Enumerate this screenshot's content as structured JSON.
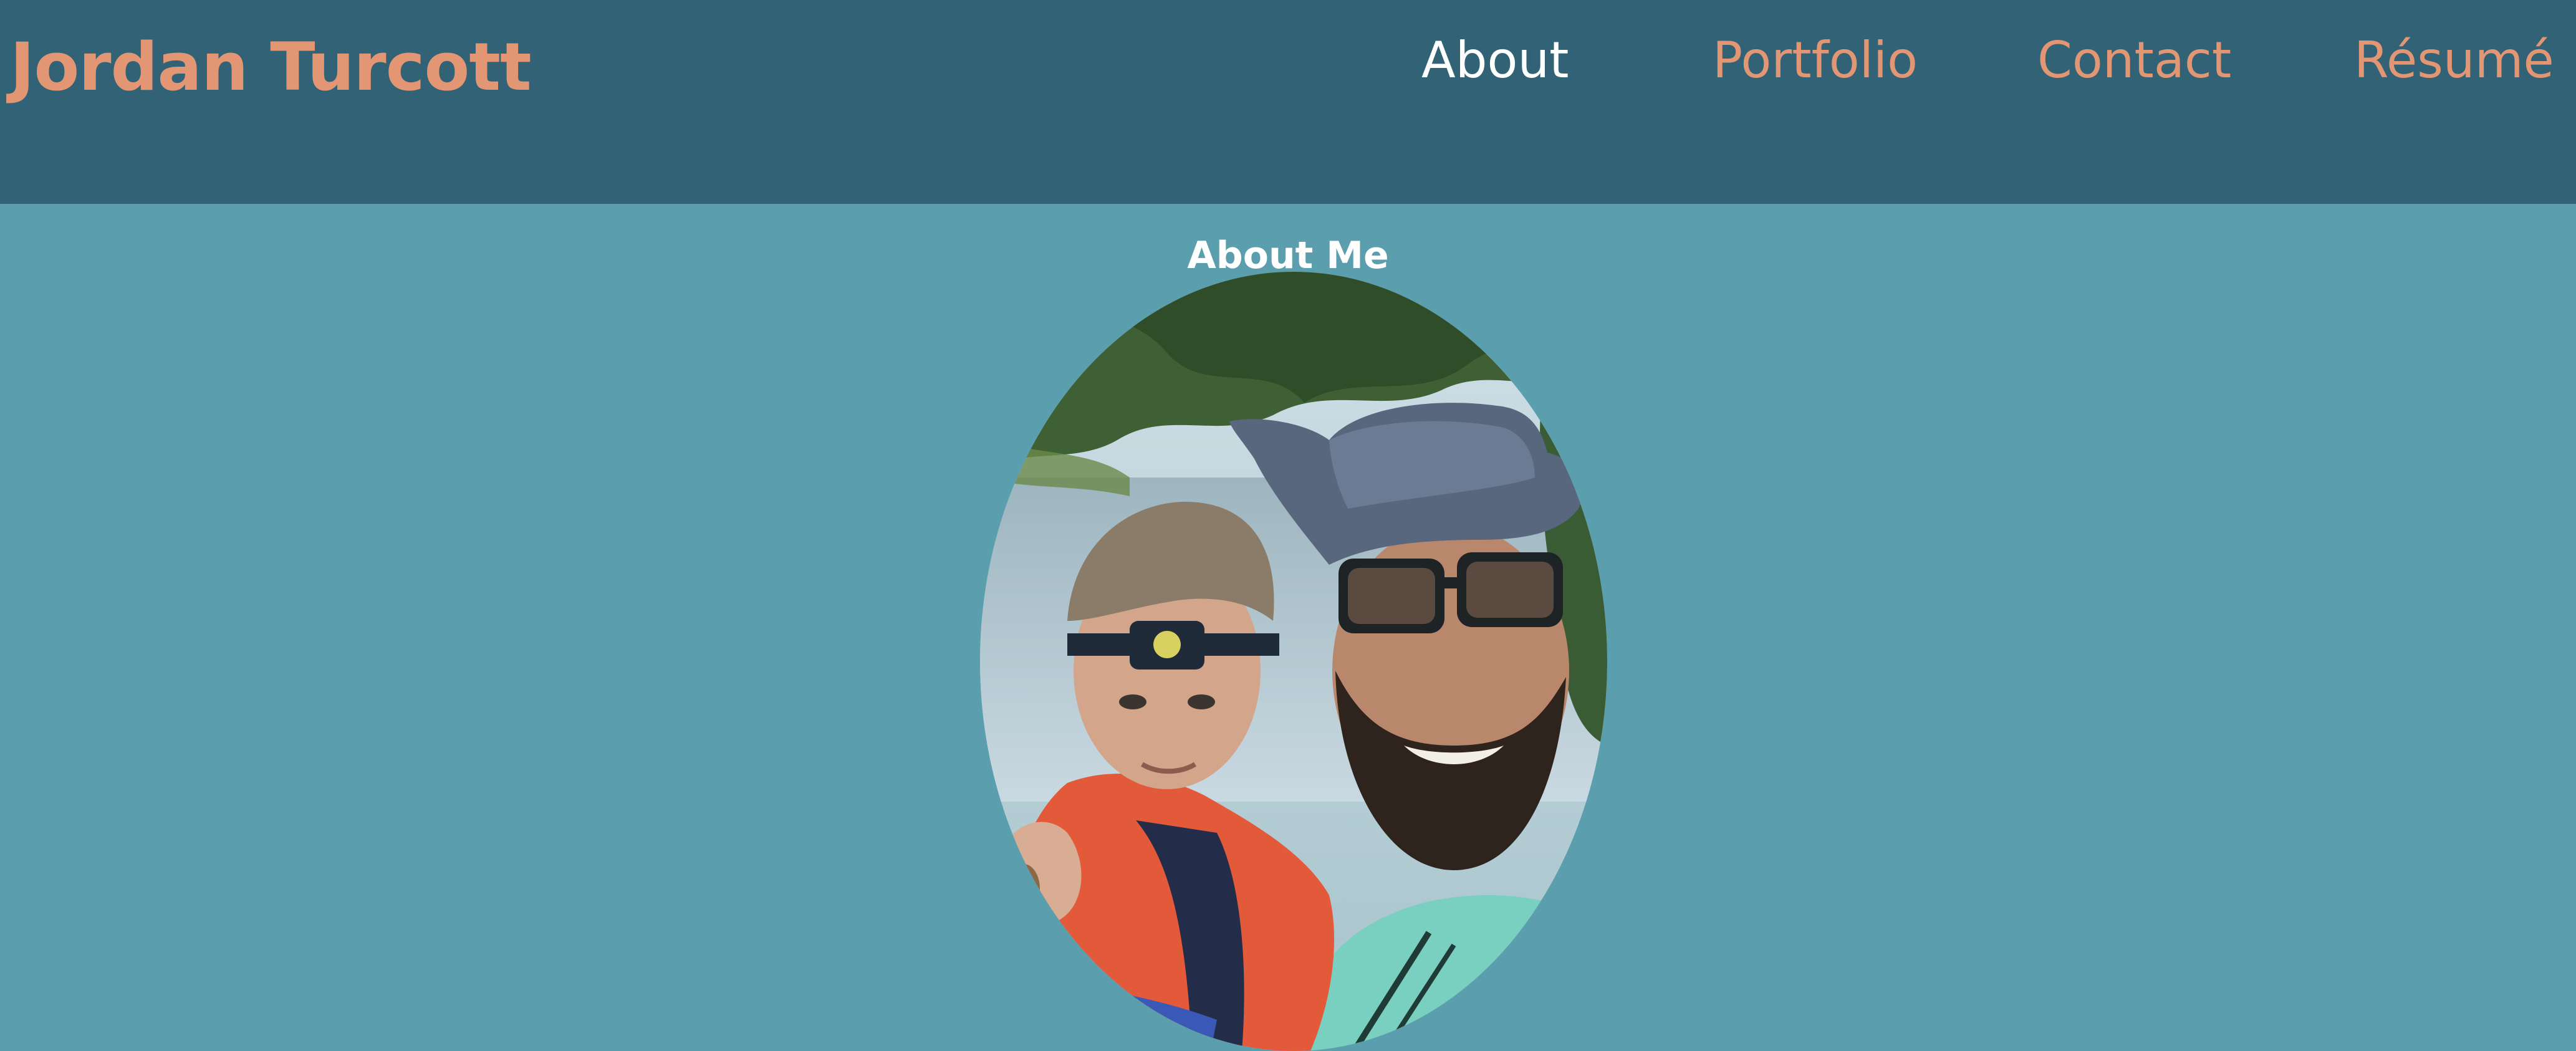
{
  "header": {
    "brand": "Jordan Turcott",
    "nav": [
      {
        "label": "About",
        "active": true
      },
      {
        "label": "Portfolio",
        "active": false
      },
      {
        "label": "Contact",
        "active": false
      },
      {
        "label": "Résumé",
        "active": false
      }
    ]
  },
  "main": {
    "title": "About Me",
    "photo_icon": "profile-photo"
  },
  "colors": {
    "header_bg": "#326275",
    "page_bg": "#5b9eae",
    "accent": "#e29673",
    "active_nav": "#ffffff"
  }
}
